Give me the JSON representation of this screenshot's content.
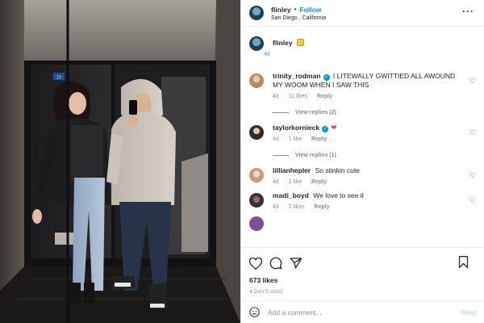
{
  "post": {
    "author": "flinley",
    "follow_label": "Follow",
    "location": "San Diego , California",
    "caption_username": "flinley",
    "caption_age": "4d",
    "likes": "673 likes",
    "date": "4 DAYS AGO"
  },
  "comments": [
    {
      "username": "trinity_rodman",
      "verified": true,
      "text": "I LITEWALLY GWITTIED ALL AWOUND MY WOOM WHEN I SAW THIS",
      "age": "4d",
      "likes": "11 likes",
      "reply": "Reply",
      "view_replies": "View replies (2)"
    },
    {
      "username": "taylorkornieck",
      "verified": true,
      "text": "",
      "age": "4d",
      "likes": "1 like",
      "reply": "Reply",
      "view_replies": "View replies (1)"
    },
    {
      "username": "lillianhepler",
      "verified": false,
      "text": "So stinkin cute",
      "age": "4d",
      "likes": "1 like",
      "reply": "Reply"
    },
    {
      "username": "madi_boyd",
      "verified": false,
      "text": "We love to see it",
      "age": "4d",
      "likes": "2 likes",
      "reply": "Reply"
    }
  ],
  "add_comment": {
    "placeholder": "Add a comment...",
    "post_label": "Post"
  },
  "icons": {
    "more": "more-options-icon",
    "like": "heart-icon",
    "comment": "comment-icon",
    "share": "share-icon",
    "save": "bookmark-icon",
    "emoji": "emoji-icon"
  },
  "colors": {
    "link": "#0095f6",
    "verified": "#0095f6",
    "heart": "#ed4956",
    "muted": "#8e8e8e",
    "post_disabled": "#b3dbff"
  },
  "media": {
    "elevator_floor_label": "10"
  }
}
